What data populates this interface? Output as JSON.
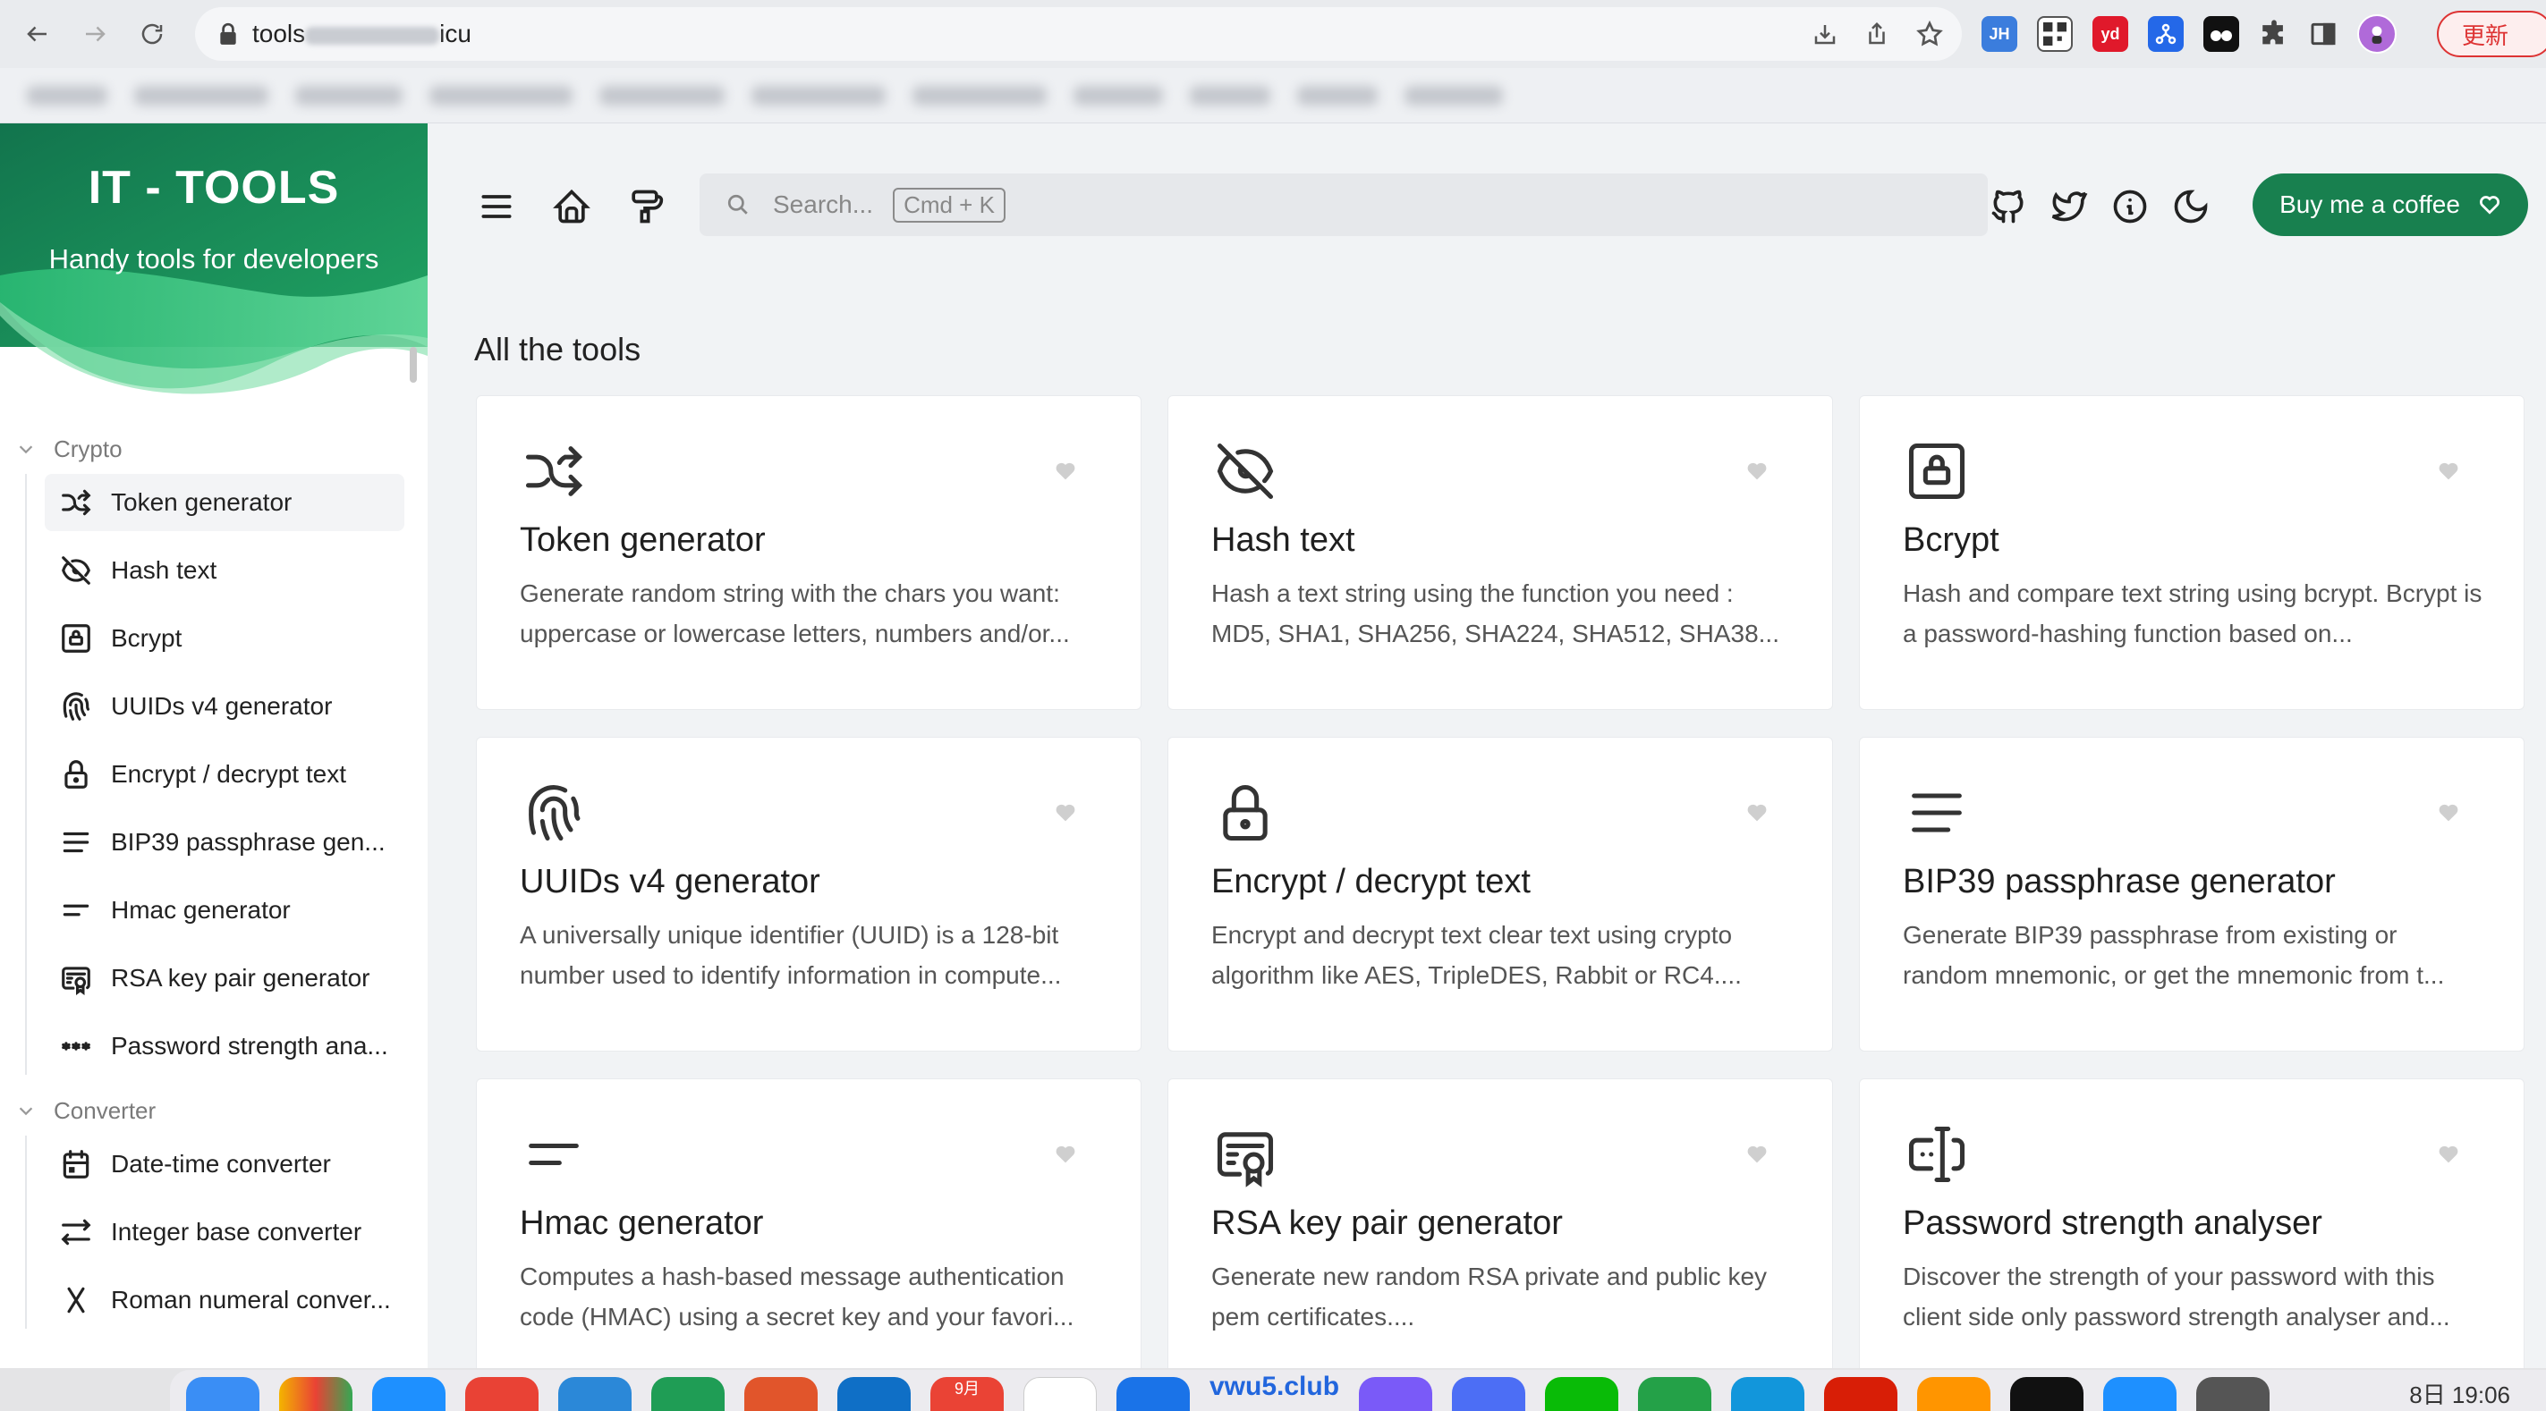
{
  "browser": {
    "url_start": "tools",
    "url_end": "icu",
    "update_label": "更新",
    "extensions": [
      {
        "name": "jh-extension",
        "label": "JH",
        "color": "#3b7ddd"
      },
      {
        "name": "qr-extension",
        "label": "",
        "color": "#555555"
      },
      {
        "name": "youdao-extension",
        "label": "yd",
        "color": "#e0192b"
      },
      {
        "name": "sourcetree-extension",
        "label": "",
        "color": "#2468e8"
      },
      {
        "name": "glasses-extension",
        "label": "",
        "color": "#111111"
      }
    ]
  },
  "brand": {
    "title": "IT - TOOLS",
    "subtitle": "Handy tools for developers",
    "gradient_from": "#1d8a5b",
    "gradient_to": "#31c07b"
  },
  "sidebar": {
    "groups": [
      {
        "label": "Crypto",
        "items": [
          {
            "label": "Token generator",
            "icon": "shuffle-icon"
          },
          {
            "label": "Hash text",
            "icon": "eye-off-icon"
          },
          {
            "label": "Bcrypt",
            "icon": "lock-square-icon"
          },
          {
            "label": "UUIDs v4 generator",
            "icon": "fingerprint-icon"
          },
          {
            "label": "Encrypt / decrypt text",
            "icon": "lock-icon"
          },
          {
            "label": "BIP39 passphrase gen...",
            "icon": "align-justify-icon"
          },
          {
            "label": "Hmac generator",
            "icon": "short-text-icon"
          },
          {
            "label": "RSA key pair generator",
            "icon": "certificate-icon"
          },
          {
            "label": "Password strength ana...",
            "icon": "password-icon"
          }
        ]
      },
      {
        "label": "Converter",
        "items": [
          {
            "label": "Date-time converter",
            "icon": "calendar-icon"
          },
          {
            "label": "Integer base converter",
            "icon": "arrows-left-right-icon"
          },
          {
            "label": "Roman numeral conver...",
            "icon": "letter-x-icon"
          }
        ]
      }
    ]
  },
  "header": {
    "search_placeholder": "Search...",
    "search_shortcut": "Cmd + K",
    "coffee_label": "Buy me a coffee",
    "accent": "#18804f"
  },
  "main": {
    "section_title": "All the tools",
    "cards": [
      {
        "title": "Token generator",
        "icon": "shuffle-icon",
        "desc": "Generate random string with the chars you want: uppercase or lowercase letters, numbers and/or..."
      },
      {
        "title": "Hash text",
        "icon": "eye-off-icon",
        "desc": "Hash a text string using the function you need : MD5, SHA1, SHA256, SHA224, SHA512, SHA38..."
      },
      {
        "title": "Bcrypt",
        "icon": "lock-square-icon",
        "desc": "Hash and compare text string using bcrypt. Bcrypt is a password-hashing function based on..."
      },
      {
        "title": "UUIDs v4 generator",
        "icon": "fingerprint-icon",
        "desc": "A universally unique identifier (UUID) is a 128-bit number used to identify information in compute..."
      },
      {
        "title": "Encrypt / decrypt text",
        "icon": "lock-icon",
        "desc": "Encrypt and decrypt text clear text using crypto algorithm like AES, TripleDES, Rabbit or RC4...."
      },
      {
        "title": "BIP39 passphrase generator",
        "icon": "align-justify-icon",
        "desc": "Generate BIP39 passphrase from existing or random mnemonic, or get the mnemonic from t..."
      },
      {
        "title": "Hmac generator",
        "icon": "short-text-icon",
        "desc": "Computes a hash-based message authentication code (HMAC) using a secret key and your favori..."
      },
      {
        "title": "RSA key pair generator",
        "icon": "certificate-icon",
        "desc": "Generate new random RSA private and public key pem certificates...."
      },
      {
        "title": "Password strength analyser",
        "icon": "password-icon",
        "desc": "Discover the strength of your password with this client side only password strength analyser and..."
      }
    ]
  },
  "dock": {
    "clock": "8日 19:06",
    "calendar_month": "9月",
    "overlay_text": "vwu5.club"
  }
}
